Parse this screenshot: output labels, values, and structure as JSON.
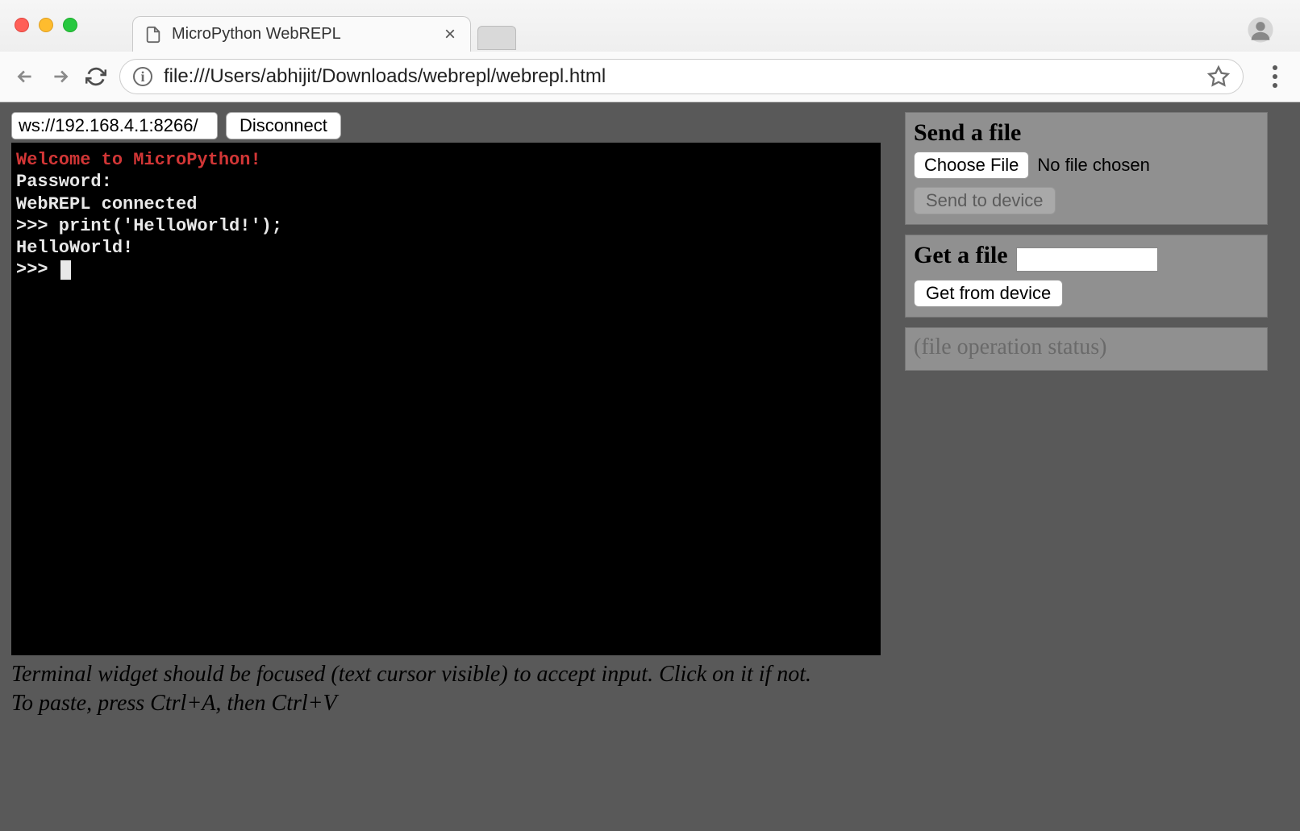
{
  "browser": {
    "tab_title": "MicroPython WebREPL",
    "url": "file:///Users/abhijit/Downloads/webrepl/webrepl.html"
  },
  "connection": {
    "ws_url": "ws://192.168.4.1:8266/",
    "disconnect_label": "Disconnect"
  },
  "terminal": {
    "welcome": "Welcome to MicroPython!",
    "lines": [
      "Password: ",
      "WebREPL connected",
      ">>> print('HelloWorld!');",
      "HelloWorld!",
      ">>> "
    ]
  },
  "hint": {
    "line1": "Terminal widget should be focused (text cursor visible) to accept input. Click on it if not.",
    "line2": "To paste, press Ctrl+A, then Ctrl+V"
  },
  "send_file": {
    "title": "Send a file",
    "choose_label": "Choose File",
    "no_file_text": "No file chosen",
    "send_label": "Send to device"
  },
  "get_file": {
    "title": "Get a file",
    "get_label": "Get from device"
  },
  "status": {
    "text": "(file operation status)"
  }
}
